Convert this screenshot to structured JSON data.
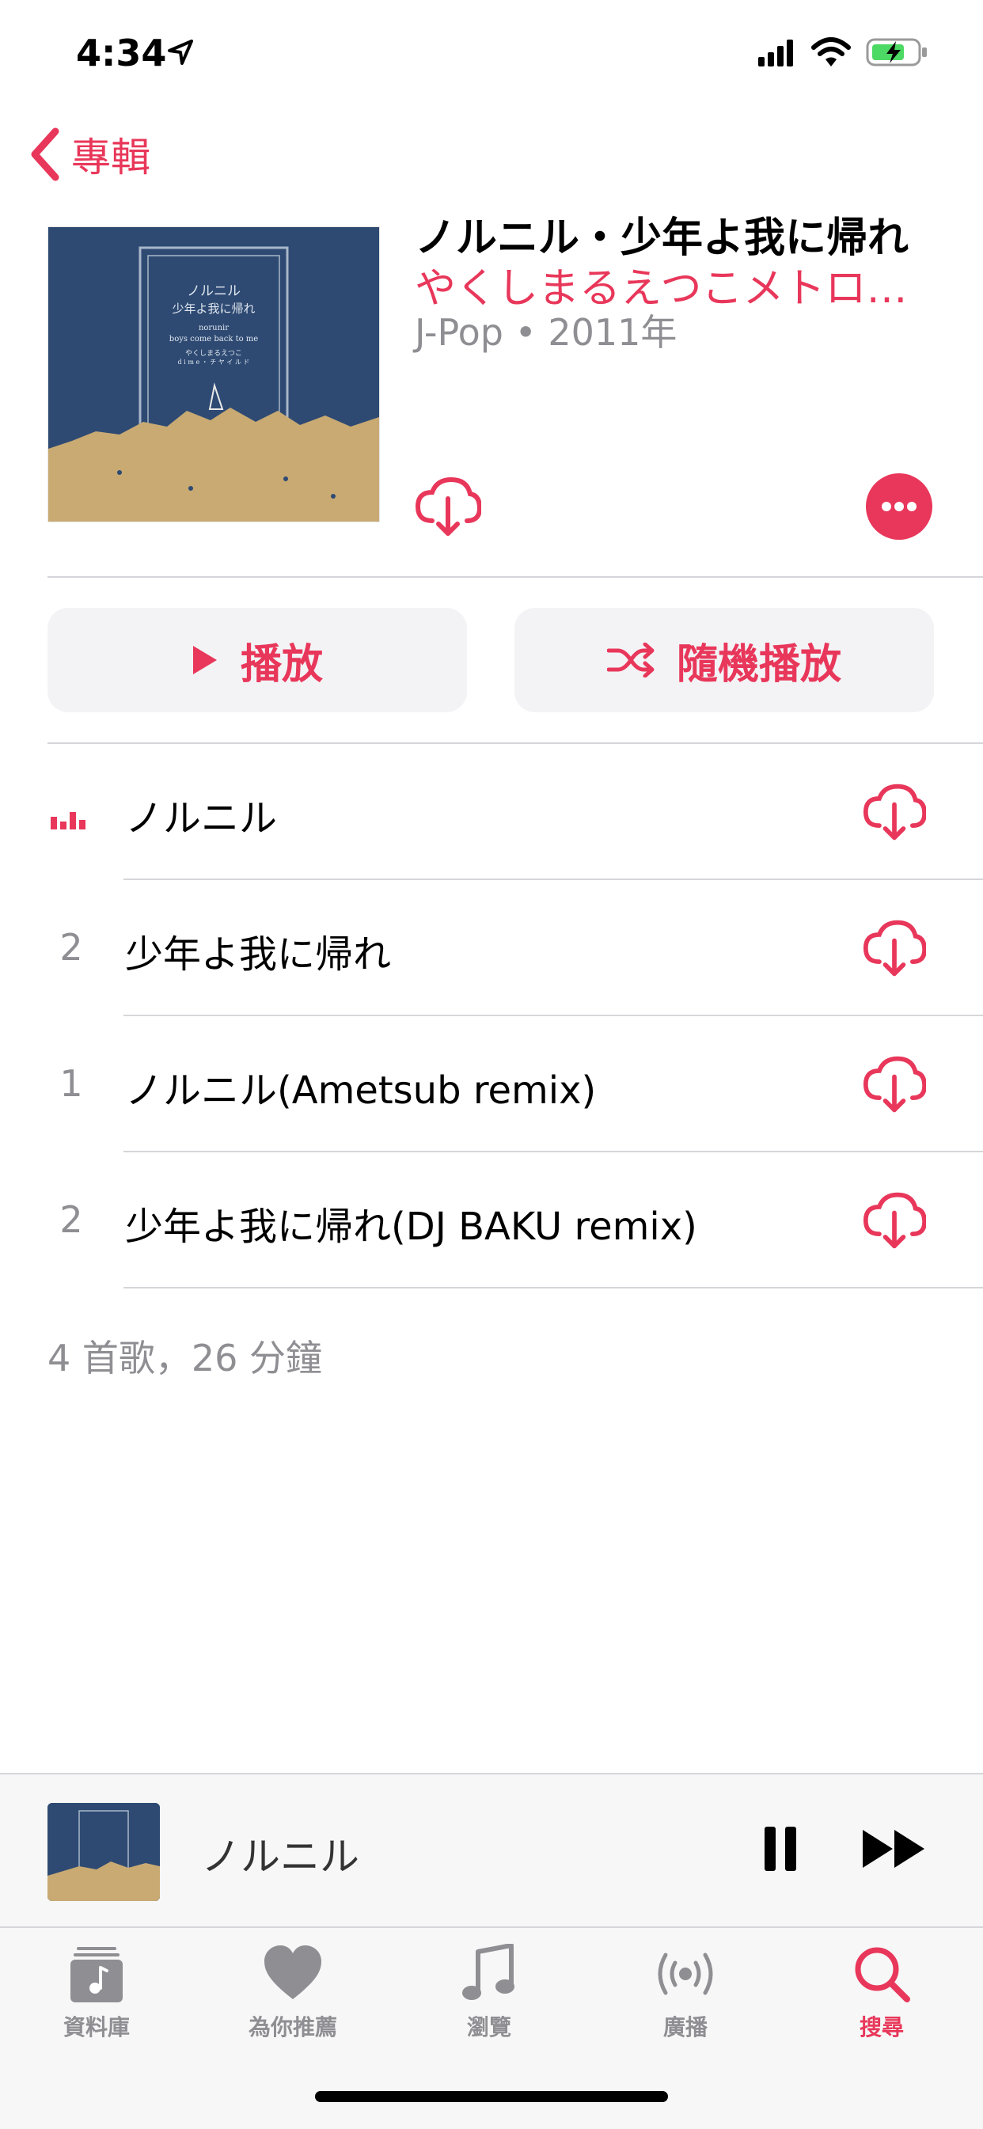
{
  "status_bar": {
    "time": "4:34"
  },
  "nav": {
    "back_label": "專輯"
  },
  "album": {
    "title": "ノルニル・少年よ我に帰れ",
    "artist": "やくしまるえつこメトロ…",
    "meta": "J-Pop • 2011年",
    "art_lines": [
      "ノルニル",
      "少年よ我に帰れ",
      "norunir",
      "boys come back to me",
      "やくしまるえつこ",
      "d i m e ・ チ ヤ イ ル ド"
    ]
  },
  "actions": {
    "play_label": "播放",
    "shuffle_label": "隨機播放"
  },
  "tracks": [
    {
      "number": "",
      "title": "ノルニル",
      "playing": true
    },
    {
      "number": "2",
      "title": "少年よ我に帰れ"
    },
    {
      "number": "1",
      "title": "ノルニル(Ametsub remix)"
    },
    {
      "number": "2",
      "title": "少年よ我に帰れ(DJ BAKU remix)"
    }
  ],
  "summary": "4 首歌，26 分鐘",
  "mini_player": {
    "title": "ノルニル"
  },
  "tabs": [
    {
      "label": "資料庫",
      "icon": "library-icon",
      "active": false
    },
    {
      "label": "為你推薦",
      "icon": "heart-icon",
      "active": false
    },
    {
      "label": "瀏覽",
      "icon": "music-note-icon",
      "active": false
    },
    {
      "label": "廣播",
      "icon": "radio-icon",
      "active": false
    },
    {
      "label": "搜尋",
      "icon": "search-icon",
      "active": true
    }
  ],
  "colors": {
    "accent": "#e8375a",
    "gray": "#8e8e93",
    "album_blue": "#2e4a73",
    "album_gold": "#c8aa72"
  }
}
